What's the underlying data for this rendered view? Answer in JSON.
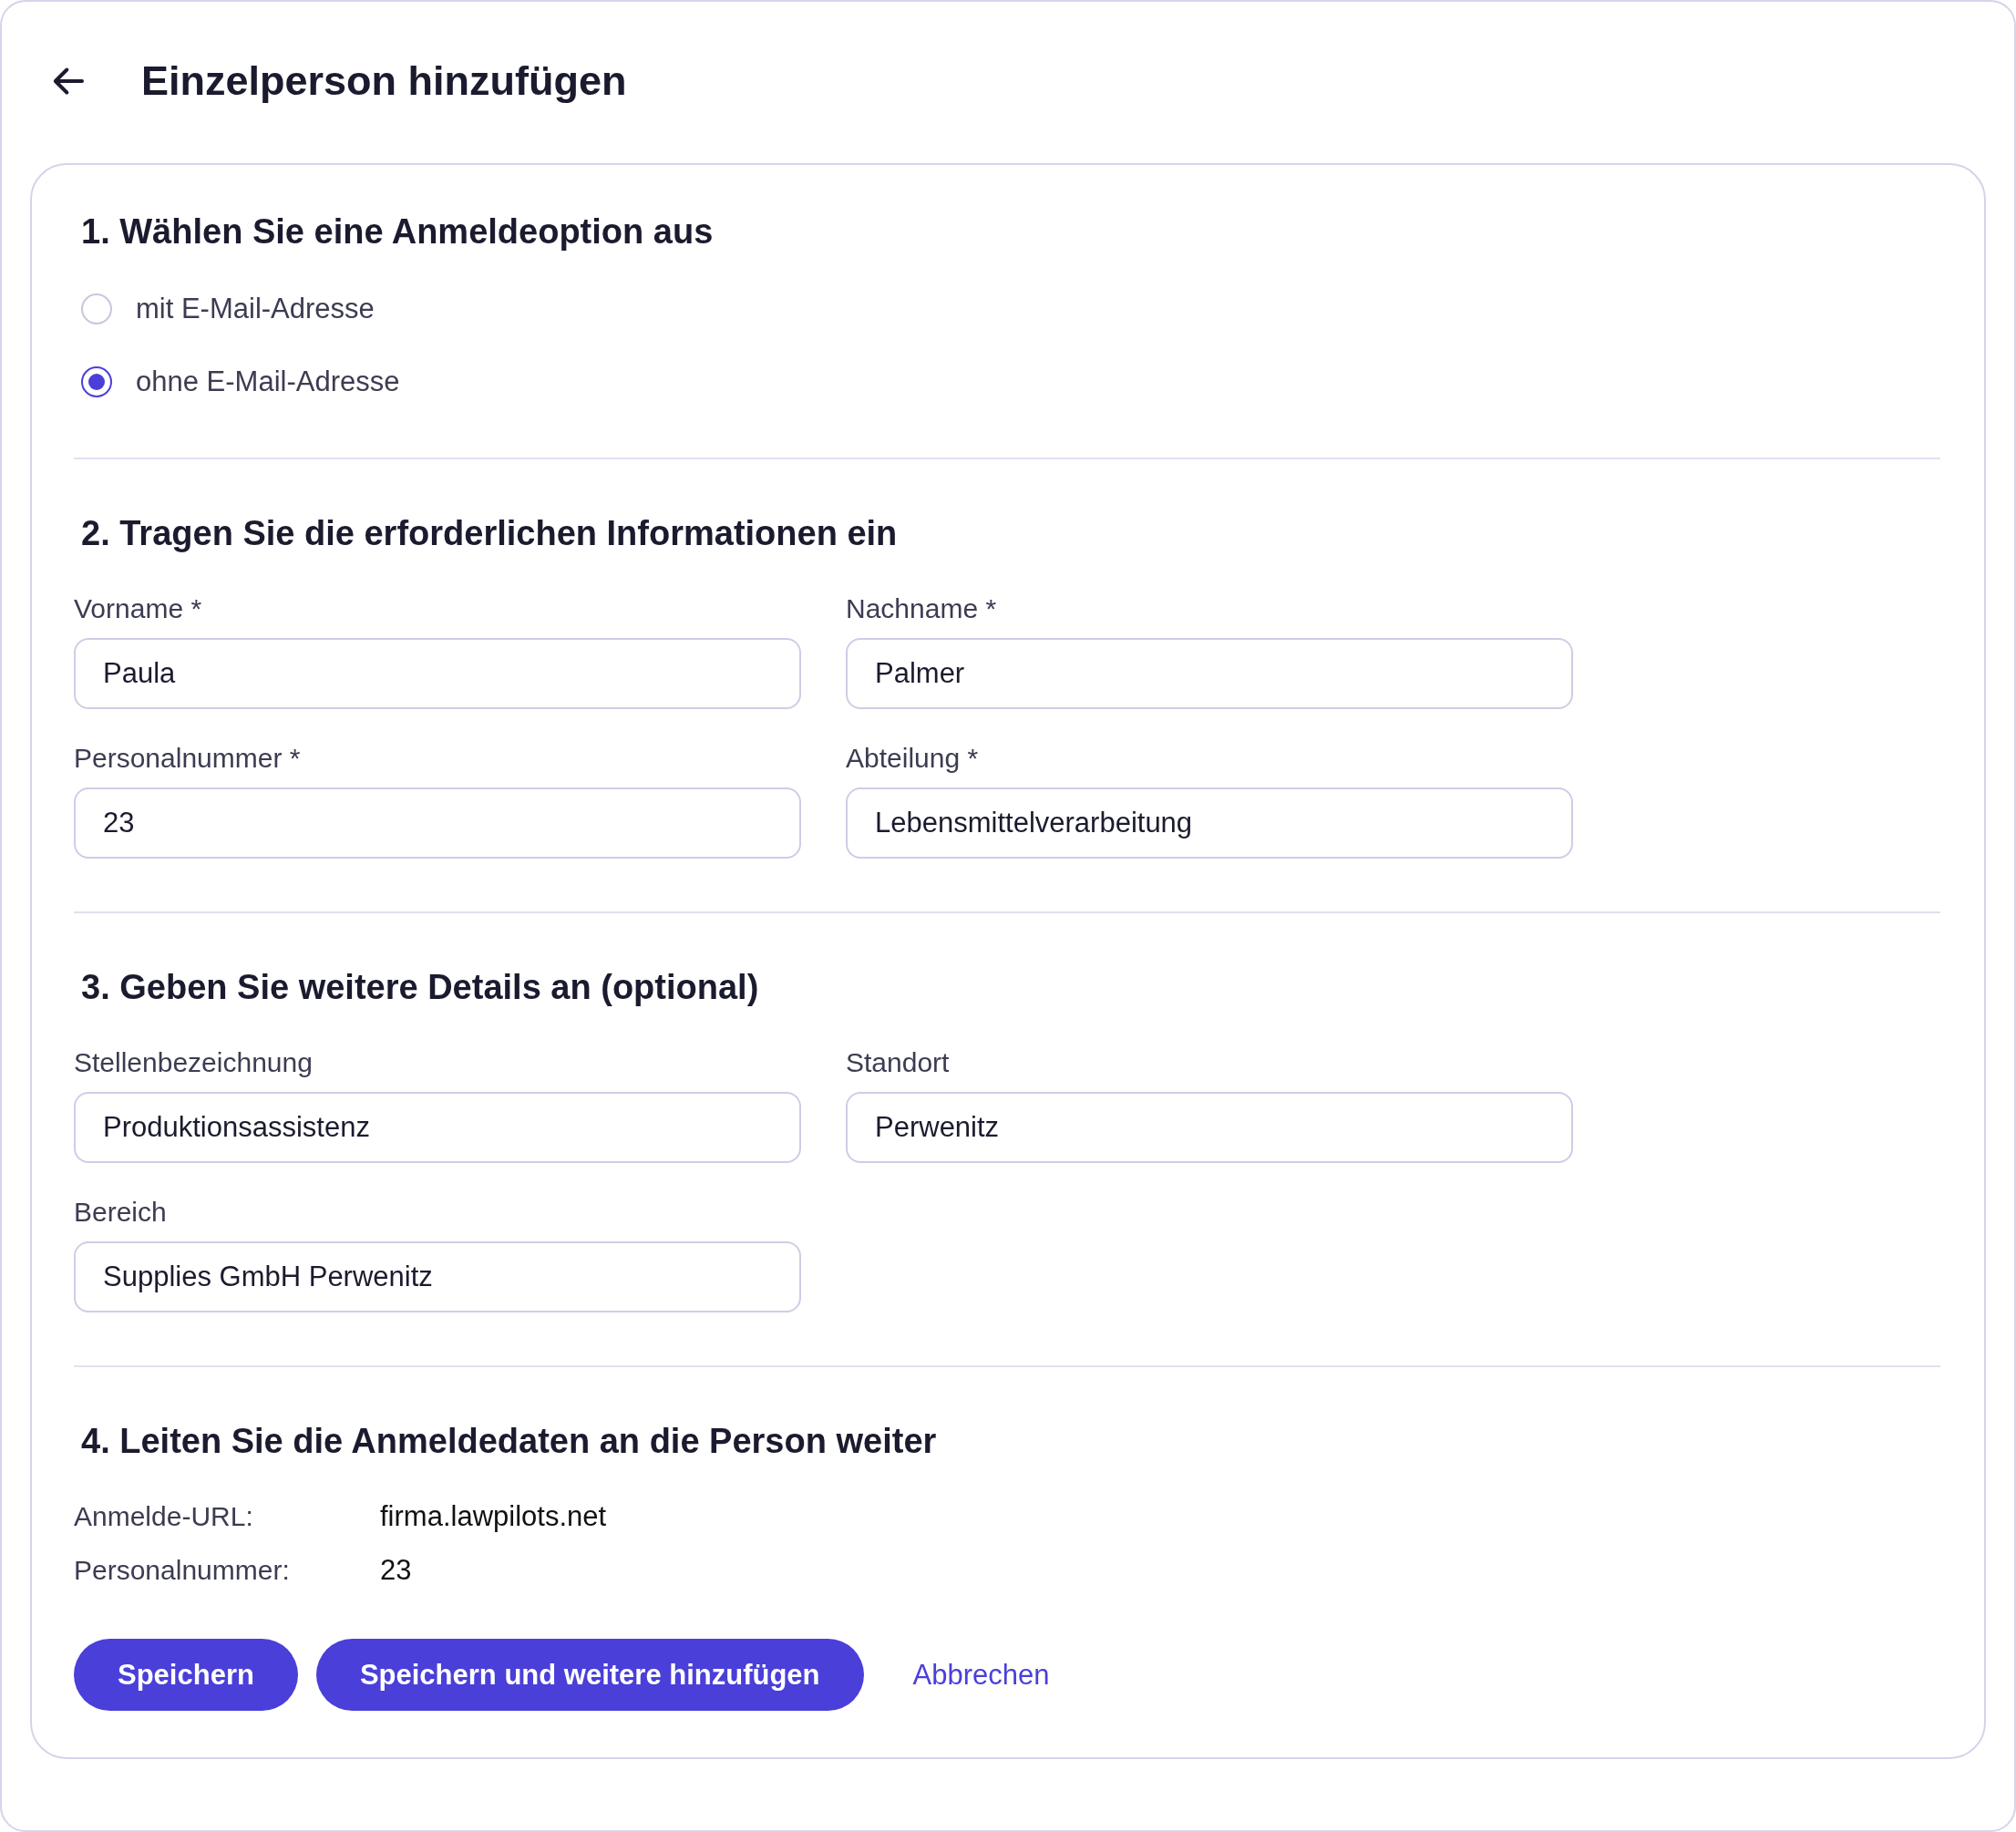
{
  "header": {
    "title": "Einzelperson hinzufügen"
  },
  "sections": [
    {
      "kind": "radio",
      "heading": "1. Wählen Sie eine Anmeldeoption aus",
      "options": [
        {
          "label": "mit E-Mail-Adresse",
          "selected": false
        },
        {
          "label": "ohne E-Mail-Adresse",
          "selected": true
        }
      ]
    },
    {
      "kind": "fields",
      "heading": "2. Tragen Sie die erforderlichen Informationen ein",
      "fields": [
        {
          "label": "Vorname *",
          "value": "Paula"
        },
        {
          "label": "Nachname *",
          "value": "Palmer"
        },
        {
          "label": "Personalnummer *",
          "value": "23"
        },
        {
          "label": "Abteilung *",
          "value": "Lebensmittelverarbeitung"
        }
      ]
    },
    {
      "kind": "fields",
      "heading": "3. Geben Sie weitere Details an (optional)",
      "fields": [
        {
          "label": "Stellenbezeichnung",
          "value": "Produktionsassistenz"
        },
        {
          "label": "Standort",
          "value": "Perwenitz"
        },
        {
          "label": "Bereich",
          "value": "Supplies GmbH Perwenitz"
        }
      ]
    },
    {
      "kind": "info",
      "heading": "4. Leiten Sie die Anmeldedaten an die Person weiter",
      "rows": [
        {
          "label": "Anmelde-URL:",
          "value": "firma.lawpilots.net"
        },
        {
          "label": "Personalnummer:",
          "value": "23"
        }
      ]
    }
  ],
  "actions": {
    "buttons": [
      "Speichern",
      "Speichern und weitere hinzufügen"
    ],
    "link": "Abbrechen"
  }
}
